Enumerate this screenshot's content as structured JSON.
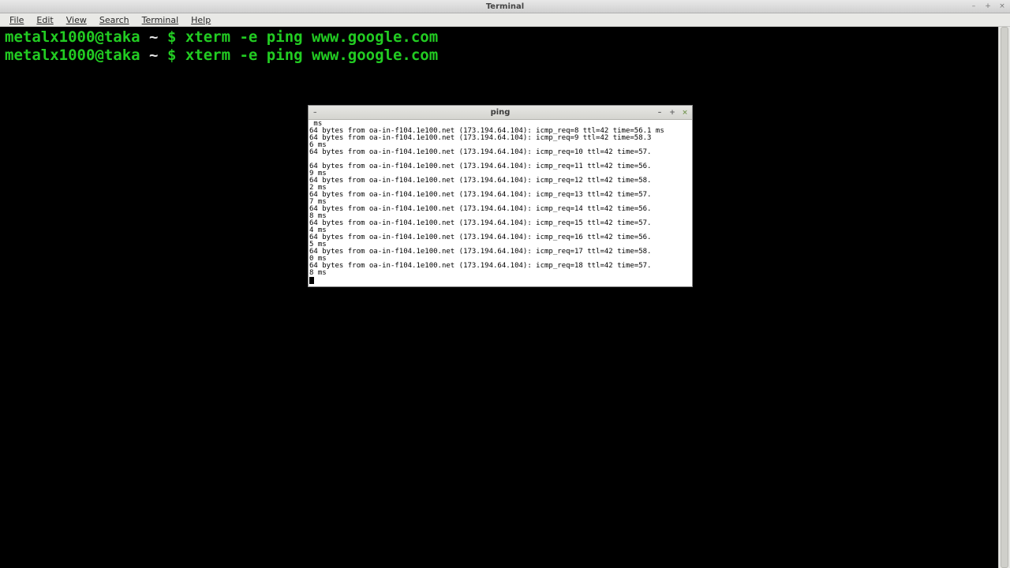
{
  "main_window": {
    "title": "Terminal",
    "controls": {
      "minimize": "–",
      "maximize": "+",
      "close": "×"
    }
  },
  "menubar": {
    "items": [
      "File",
      "Edit",
      "View",
      "Search",
      "Terminal",
      "Help"
    ]
  },
  "terminal": {
    "prompt_user": "metalx1000@taka",
    "prompt_path": "~",
    "prompt_symbol": "$",
    "command": "xterm -e ping www.google.com",
    "lines": [
      {
        "cmd": "xterm -e ping www.google.com"
      },
      {
        "cmd": "xterm -e ping www.google.com"
      }
    ]
  },
  "xterm": {
    "title": "ping",
    "controls": {
      "menu": "–",
      "minimize": "–",
      "maximize": "+",
      "close": "×"
    },
    "host": "oa-in-f104.1e100.net",
    "ip": "173.194.64.104",
    "ttl": 42,
    "lead_ms": " ms",
    "lines": [
      {
        "seq": 8,
        "time": "56.1"
      },
      {
        "seq": 9,
        "time": "58.3",
        "wrap_ms": "6 ms"
      },
      {
        "seq": 10,
        "time": "57.",
        "wrap_ms": ""
      },
      {
        "seq": 11,
        "time": "56.",
        "wrap_ms": "9 ms"
      },
      {
        "seq": 12,
        "time": "58.",
        "wrap_ms": "2 ms"
      },
      {
        "seq": 13,
        "time": "57.",
        "wrap_ms": "7 ms"
      },
      {
        "seq": 14,
        "time": "56.",
        "wrap_ms": "8 ms"
      },
      {
        "seq": 15,
        "time": "57.",
        "wrap_ms": "4 ms"
      },
      {
        "seq": 16,
        "time": "56.",
        "wrap_ms": "5 ms"
      },
      {
        "seq": 17,
        "time": "58.",
        "wrap_ms": "0 ms"
      },
      {
        "seq": 18,
        "time": "57.",
        "wrap_ms": "8 ms"
      }
    ]
  }
}
